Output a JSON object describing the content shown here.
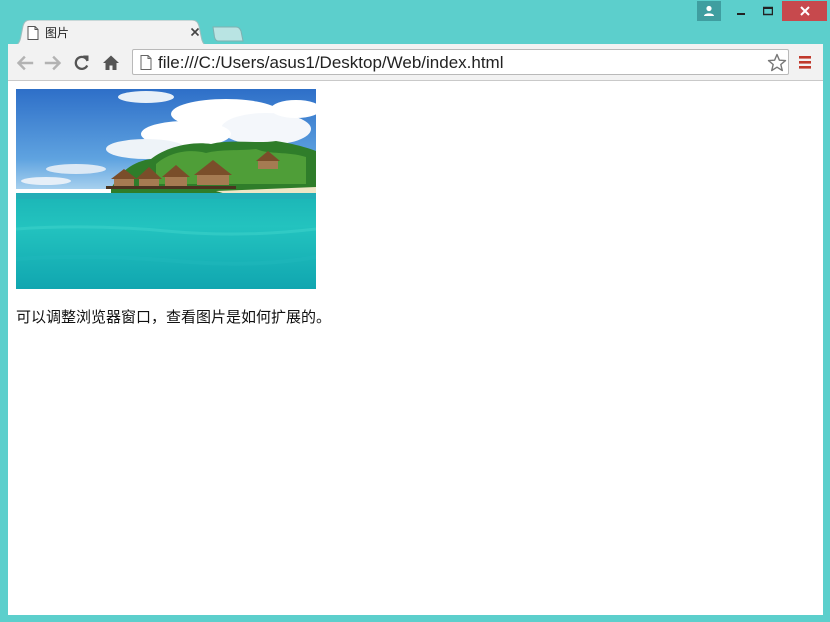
{
  "tab": {
    "title": "图片"
  },
  "address_bar": {
    "url": "file:///C:/Users/asus1/Desktop/Web/index.html"
  },
  "page": {
    "caption": "可以调整浏览器窗口，查看图片是如何扩展的。"
  },
  "icons": {
    "user": "user-icon",
    "minimize": "minimize-icon",
    "maximize": "maximize-icon",
    "close": "close-icon",
    "back": "back-arrow-icon",
    "forward": "forward-arrow-icon",
    "reload": "reload-icon",
    "home": "home-icon",
    "page": "page-icon",
    "star": "star-icon",
    "menu": "hamburger-menu-icon"
  },
  "colors": {
    "frame": "#5ccfcc",
    "close_button": "#c7494d",
    "menu_accent": "#c0392b"
  }
}
